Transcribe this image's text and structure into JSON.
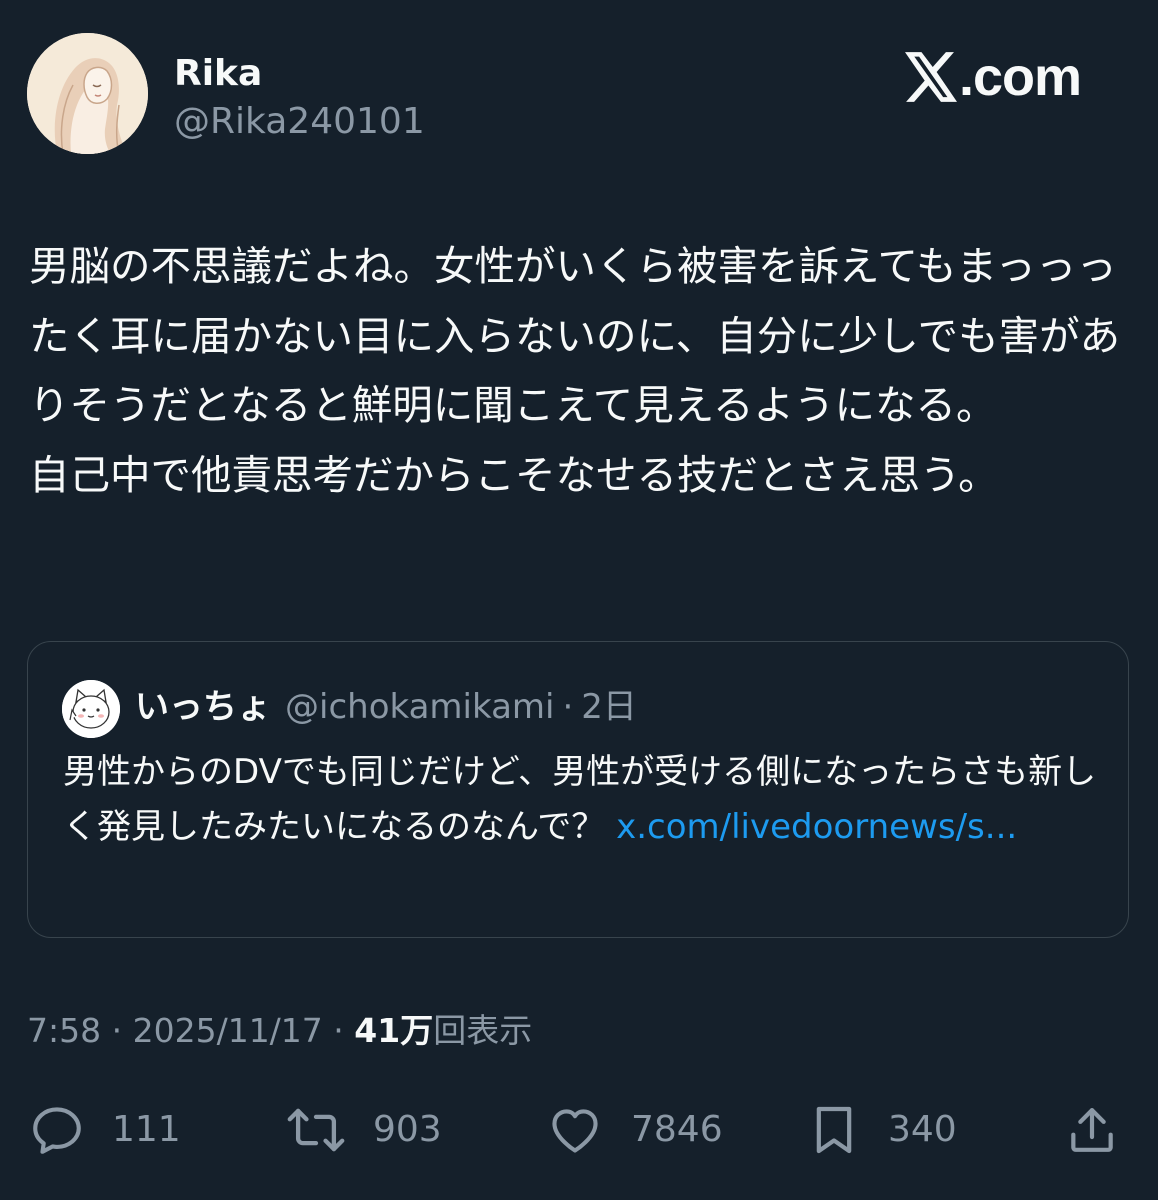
{
  "author": {
    "name": "Rika",
    "handle": "@Rika240101"
  },
  "brand": {
    "icon": "x-logo-icon",
    "text": ".com"
  },
  "tweet": {
    "text": "男脳の不思議だよね。女性がいくら被害を訴えてもまっっったく耳に届かない目に入らないのに、自分に少しでも害がありそうだとなると鮮明に聞こえて見えるようになる。\n自己中で他責思考だからこそなせる技だとさえ思う。"
  },
  "quote": {
    "name": "いっちょ",
    "handle": "@ichokamikami",
    "separator": "·",
    "time": "2日",
    "text": "男性からのDVでも同じだけど、男性が受ける側になったらさも新しく発見したみたいになるのなんで？ ",
    "link": "x.com/livedoornews/s..."
  },
  "meta": {
    "time": "7:58",
    "sep1": " · ",
    "date": "2025/11/17",
    "sep2": " · ",
    "views": "41万",
    "views_label": "回表示"
  },
  "actions": [
    {
      "name": "reply",
      "icon": "reply-icon",
      "count": "111"
    },
    {
      "name": "retweet",
      "icon": "retweet-icon",
      "count": "903"
    },
    {
      "name": "like",
      "icon": "heart-icon",
      "count": "7846"
    },
    {
      "name": "bookmark",
      "icon": "bookmark-icon",
      "count": "340"
    },
    {
      "name": "share",
      "icon": "share-icon"
    }
  ],
  "colors": {
    "background": "#15202b",
    "text": "#f7f9f9",
    "secondary": "#8b98a5",
    "link": "#1d9bf0",
    "border": "#38444d"
  }
}
